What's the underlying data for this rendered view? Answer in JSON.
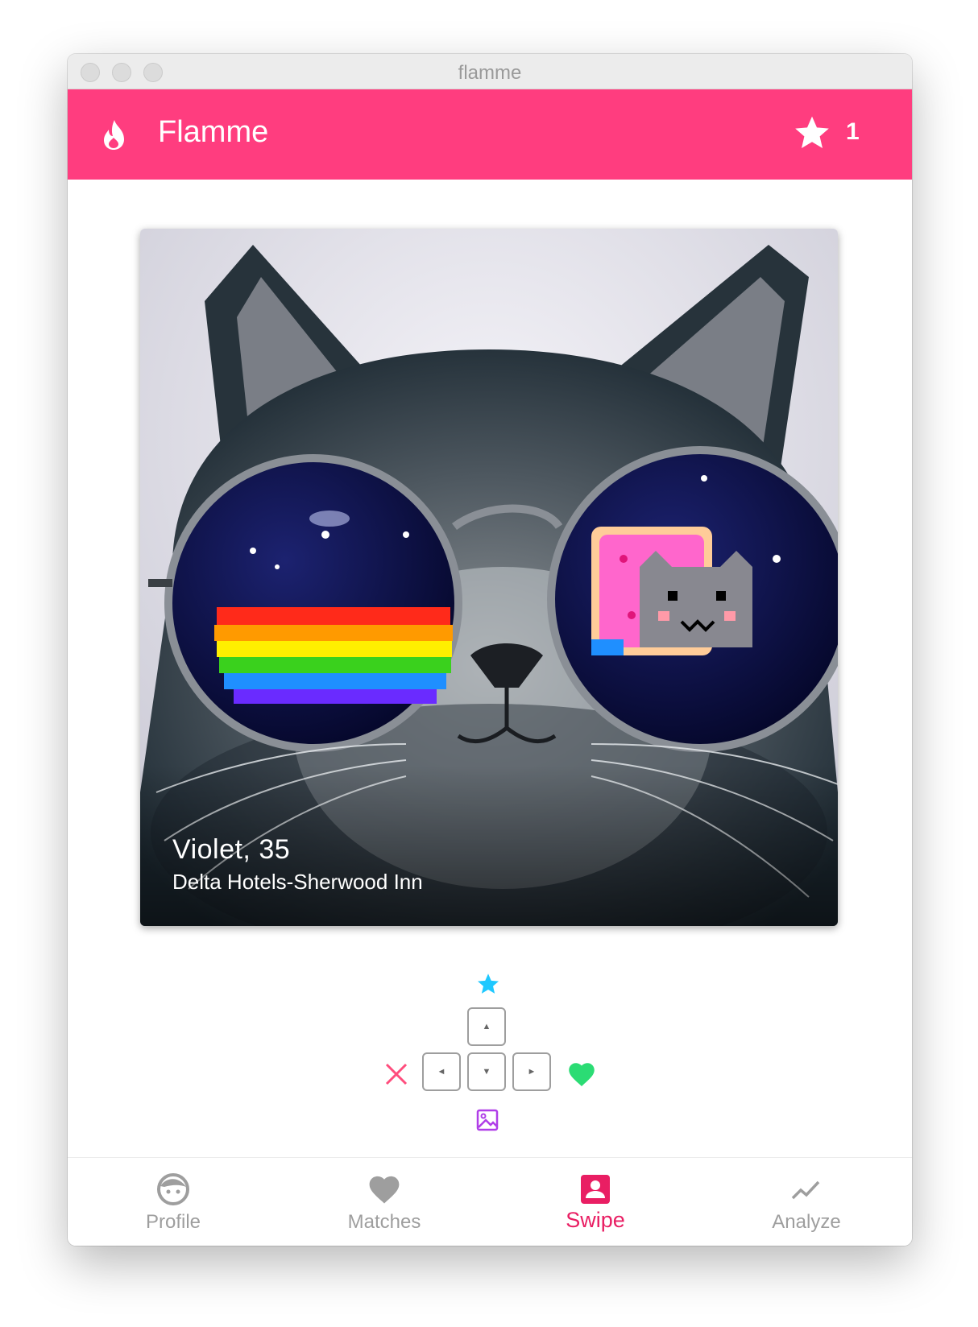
{
  "window": {
    "title": "flamme"
  },
  "appbar": {
    "title": "Flamme",
    "logo_icon": "flame-icon",
    "star_icon": "star-icon",
    "star_count": "1",
    "color": "#ff3d7f"
  },
  "card": {
    "name_age": "Violet, 35",
    "location": "Delta Hotels-Sherwood Inn",
    "photo": "cat-with-nyan-cat-sunglasses"
  },
  "controls": {
    "superlike_icon": "star-icon",
    "superlike_color": "#1ec8ff",
    "keys": {
      "up": "▲",
      "left": "◄",
      "down": "▼",
      "right": "►"
    },
    "dislike_icon": "close-icon",
    "dislike_color": "#ff4d7d",
    "like_icon": "heart-icon",
    "like_color": "#2bdc74",
    "image_icon": "image-icon",
    "image_color": "#b03ee8"
  },
  "nav": {
    "items": [
      {
        "label": "Profile",
        "icon": "face-icon",
        "active": false
      },
      {
        "label": "Matches",
        "icon": "heart-icon",
        "active": false
      },
      {
        "label": "Swipe",
        "icon": "person-badge-icon",
        "active": true
      },
      {
        "label": "Analyze",
        "icon": "trending-icon",
        "active": false
      }
    ],
    "active_color": "#e91e63",
    "inactive_color": "#9e9e9e"
  }
}
